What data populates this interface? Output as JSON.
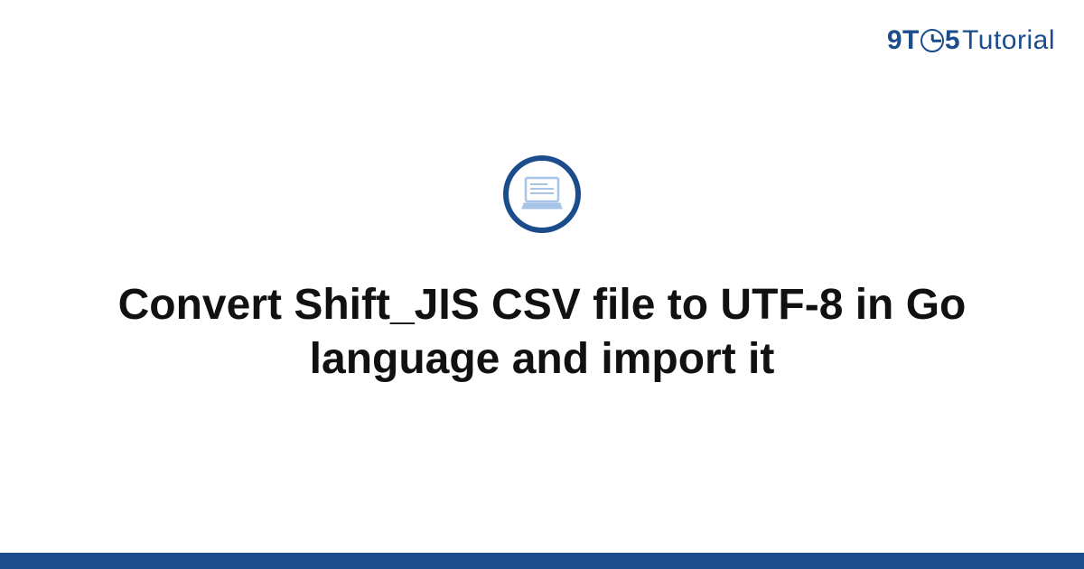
{
  "brand": {
    "part1": "9T",
    "part2": "5",
    "part3": "Tutorial"
  },
  "article": {
    "title": "Convert Shift_JIS CSV file to UTF-8 in Go language and import it"
  },
  "colors": {
    "accent": "#1b4d8c",
    "text": "#111111"
  }
}
